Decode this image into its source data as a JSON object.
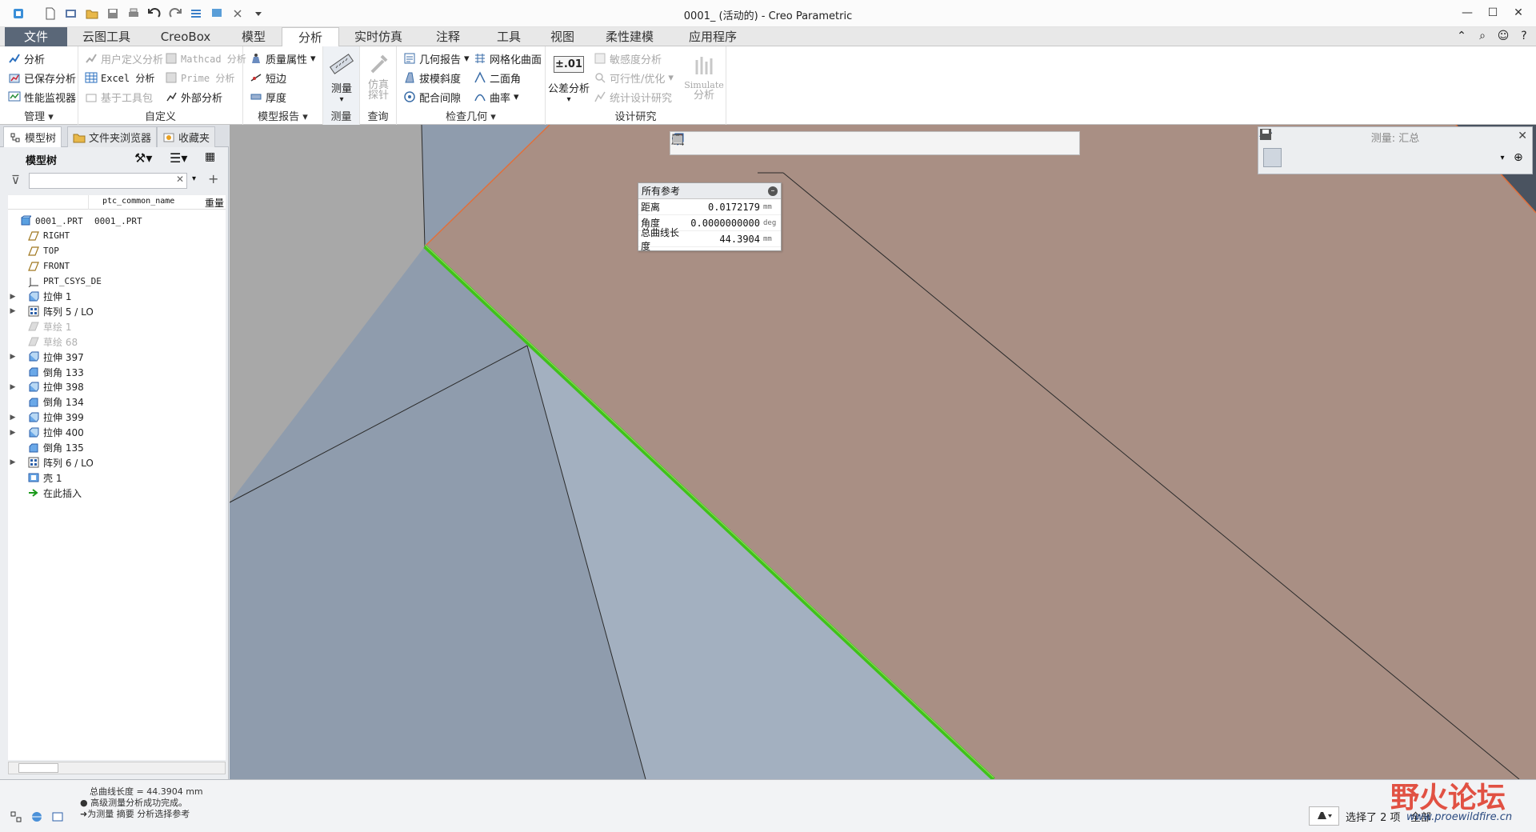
{
  "window": {
    "title": "0001_ (活动的) - Creo Parametric"
  },
  "tabs": [
    "文件",
    "云图工具",
    "CreoBox",
    "模型",
    "分析",
    "实时仿真",
    "注释",
    "工具",
    "视图",
    "柔性建模",
    "应用程序"
  ],
  "ribbon": {
    "manage": {
      "name": "管理",
      "items": [
        "分析",
        "已保存分析",
        "性能监视器"
      ]
    },
    "custom": {
      "name": "自定义",
      "items": [
        "用户定义分析",
        "Excel 分析",
        "基于工具包",
        "Mathcad 分析",
        "Prime 分析",
        "外部分析"
      ]
    },
    "model_report": {
      "name": "模型报告",
      "items": [
        "质量属性",
        "短边",
        "厚度"
      ]
    },
    "measure": {
      "name": "测量",
      "button": "测量"
    },
    "query": {
      "name": "查询",
      "button_line1": "仿真",
      "button_line2": "探针"
    },
    "inspect": {
      "name": "检查几何",
      "items": [
        "几何报告",
        "拔模斜度",
        "配合间隙",
        "网格化曲面",
        "二面角",
        "曲率"
      ]
    },
    "design_study": {
      "name": "设计研究",
      "tolerance": "公差分析",
      "tolerance_icon": "±.01",
      "items": [
        "敏感度分析",
        "可行性/优化",
        "统计设计研究"
      ],
      "simulate_line1": "Simulate",
      "simulate_line2": "分析"
    }
  },
  "left_panel": {
    "tabs": [
      "模型树",
      "文件夹浏览器",
      "收藏夹"
    ],
    "tree_title": "模型树",
    "columns": [
      "ptc_common_name",
      "重量"
    ],
    "tree": [
      {
        "label": "0001_.PRT",
        "common": "0001_.PRT",
        "icon": "part-icon",
        "expand": "",
        "indent": 0,
        "dim": false
      },
      {
        "label": "RIGHT",
        "icon": "datum-plane-icon",
        "expand": "",
        "indent": 1,
        "dim": false
      },
      {
        "label": "TOP",
        "icon": "datum-plane-icon",
        "expand": "",
        "indent": 1,
        "dim": false
      },
      {
        "label": "FRONT",
        "icon": "datum-plane-icon",
        "expand": "",
        "indent": 1,
        "dim": false
      },
      {
        "label": "PRT_CSYS_DE",
        "icon": "csys-icon",
        "expand": "",
        "indent": 1,
        "dim": false
      },
      {
        "label": "拉伸 1",
        "icon": "extrude-icon",
        "expand": "▶",
        "indent": 1,
        "dim": false
      },
      {
        "label": "阵列 5 / LO",
        "icon": "pattern-icon",
        "expand": "▶",
        "indent": 1,
        "dim": false
      },
      {
        "label": "草绘 1",
        "icon": "sketch-icon",
        "expand": "",
        "indent": 1,
        "dim": true
      },
      {
        "label": "草绘 68",
        "icon": "sketch-icon",
        "expand": "",
        "indent": 1,
        "dim": true
      },
      {
        "label": "拉伸 397",
        "icon": "extrude-icon",
        "expand": "▶",
        "indent": 1,
        "dim": false
      },
      {
        "label": "倒角 133",
        "icon": "chamfer-icon",
        "expand": "",
        "indent": 1,
        "dim": false
      },
      {
        "label": "拉伸 398",
        "icon": "extrude-icon",
        "expand": "▶",
        "indent": 1,
        "dim": false
      },
      {
        "label": "倒角 134",
        "icon": "chamfer-icon",
        "expand": "",
        "indent": 1,
        "dim": false
      },
      {
        "label": "拉伸 399",
        "icon": "extrude-icon",
        "expand": "▶",
        "indent": 1,
        "dim": false
      },
      {
        "label": "拉伸 400",
        "icon": "extrude-icon",
        "expand": "▶",
        "indent": 1,
        "dim": false
      },
      {
        "label": "倒角 135",
        "icon": "chamfer-icon",
        "expand": "",
        "indent": 1,
        "dim": false
      },
      {
        "label": "阵列 6 / LO",
        "icon": "pattern-icon",
        "expand": "▶",
        "indent": 1,
        "dim": false
      },
      {
        "label": "壳 1",
        "icon": "shell-icon",
        "expand": "",
        "indent": 1,
        "dim": false
      },
      {
        "label": "在此插入",
        "icon": "insert-arrow-icon",
        "expand": "",
        "indent": 1,
        "dim": false
      }
    ]
  },
  "measure_panel": {
    "title": "测量: 汇总"
  },
  "ref_box": {
    "header": "所有参考",
    "rows": [
      {
        "key": "距离",
        "value": "0.0172179",
        "unit": "mm"
      },
      {
        "key": "角度",
        "value": "0.0000000000",
        "unit": "deg"
      },
      {
        "key": "总曲线长度",
        "value": "44.3904",
        "unit": "mm"
      }
    ]
  },
  "status": {
    "line1": "总曲线长度 = 44.3904 mm",
    "line2": "● 高级测量分析成功完成。",
    "line3": "➜为测量 摘要 分析选择参考",
    "selection": "选择了 2 项",
    "filter": "全部"
  },
  "watermark": {
    "text_cn": "野火论坛",
    "url": "www.proewildfire.cn"
  },
  "colors": {
    "face_brown": "#a98f84",
    "face_blue": "#a3b0c0",
    "face_slate": "#8f9cad",
    "face_gray": "#a8a8a8",
    "highlight_green": "#3fc21a",
    "edge_orange": "#e0703c"
  }
}
